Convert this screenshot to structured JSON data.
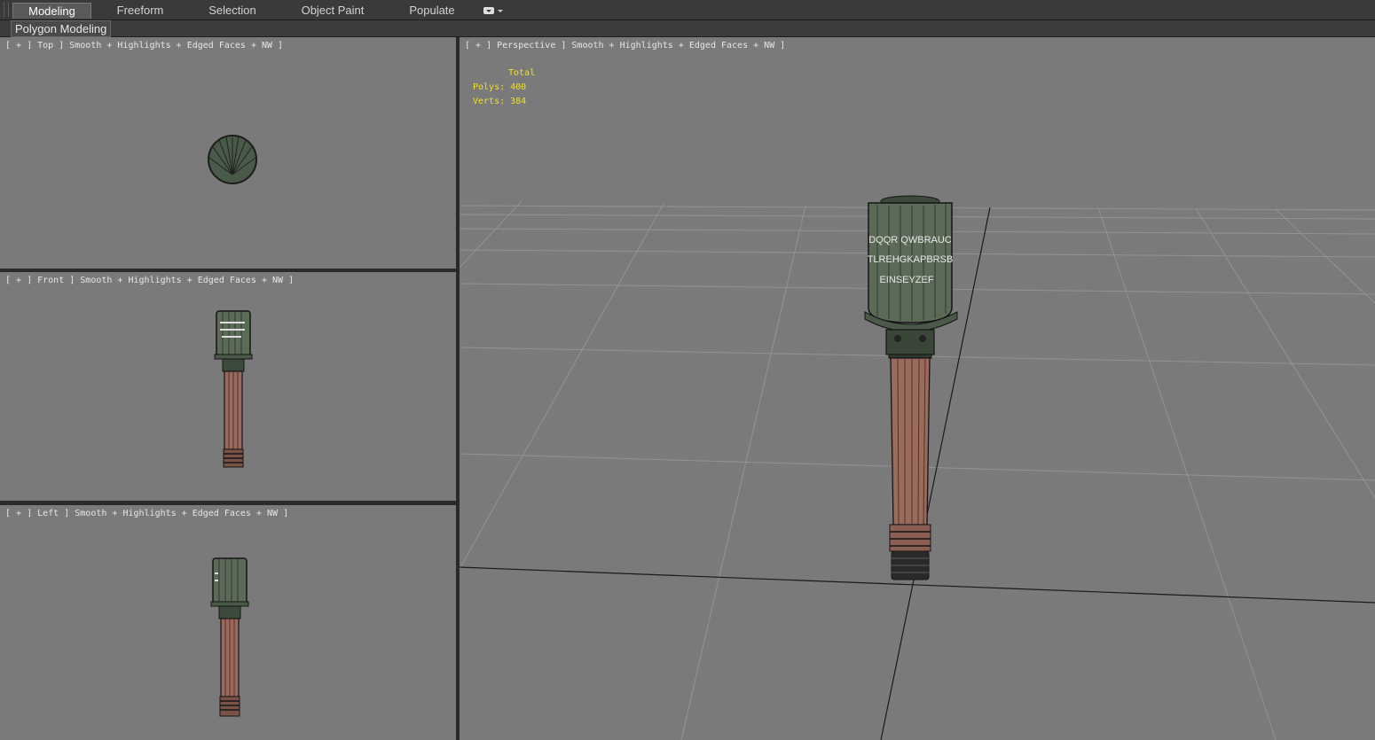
{
  "ribbon": {
    "tabs": [
      {
        "label": "Modeling"
      },
      {
        "label": "Freeform"
      },
      {
        "label": "Selection"
      },
      {
        "label": "Object Paint"
      },
      {
        "label": "Populate"
      }
    ],
    "active_tab": "Modeling",
    "dropdown_icon": "chevron-down-icon"
  },
  "subbar": {
    "panel_label": "Polygon Modeling"
  },
  "viewports": {
    "top": {
      "label": "[ + ] Top ] Smooth + Highlights + Edged Faces + NW ]"
    },
    "front": {
      "label": "[ + ] Front ] Smooth + Highlights + Edged Faces + NW ]"
    },
    "left": {
      "label": "[ + ] Left ] Smooth + Highlights + Edged Faces + NW ]"
    },
    "perspective": {
      "label": "[ + ] Perspective ] Smooth + Highlights + Edged Faces + NW ]",
      "stats": {
        "header": "Total",
        "polys": "Polys: 400",
        "verts": "Verts: 384"
      },
      "decal_text": [
        "DQQR QWBRAUC",
        "TLREHGKAPBRSB",
        "EINSEYZEF"
      ]
    }
  },
  "colors": {
    "viewport_bg": "#7a7a7a",
    "stats_text": "#f0e020",
    "head_metal": "#5c6b58",
    "handle_wood": "#9a6a5c"
  }
}
